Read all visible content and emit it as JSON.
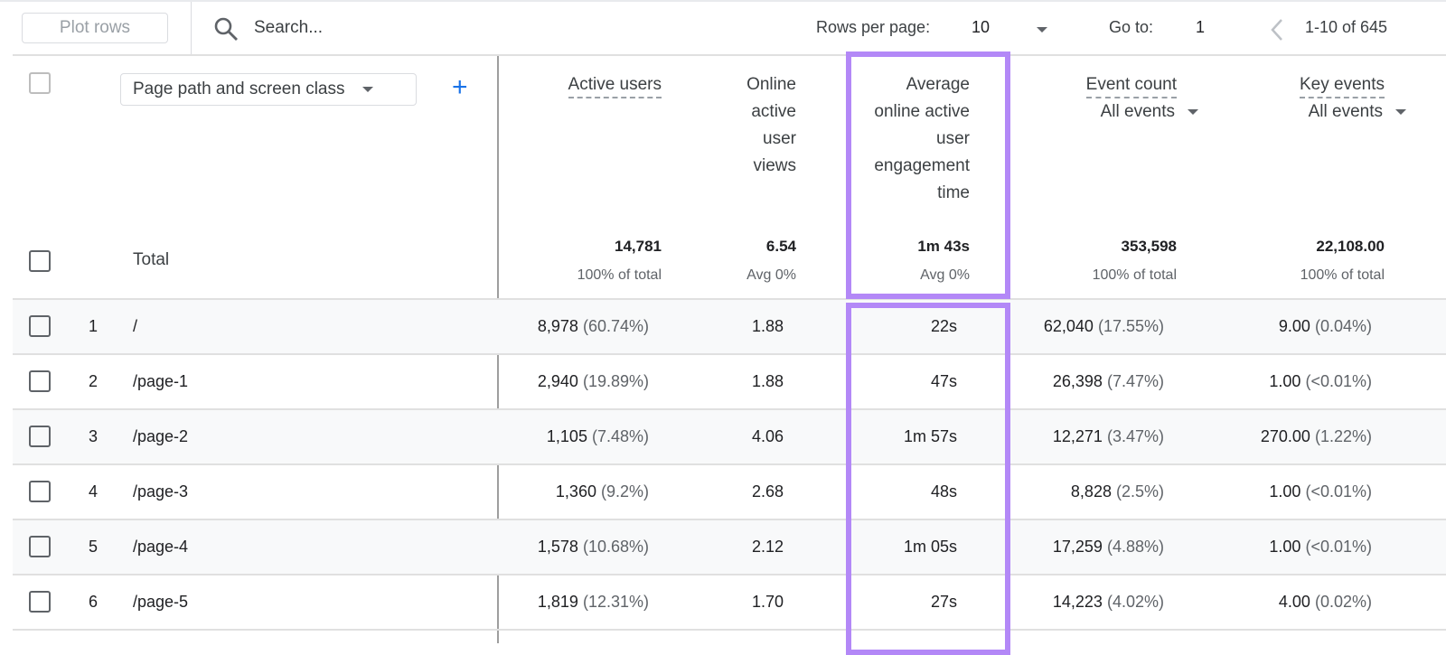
{
  "toolbar": {
    "plot_rows": "Plot rows",
    "search_placeholder": "Search...",
    "rows_per_page_label": "Rows per page:",
    "rows_per_page": "10",
    "goto_label": "Go to:",
    "goto_value": "1",
    "range": "1-10 of 645"
  },
  "dimension": {
    "label": "Page path and screen class",
    "add_icon": "plus-icon"
  },
  "columns": [
    {
      "lines": [
        "Active users"
      ],
      "dashed": true
    },
    {
      "lines": [
        "Online",
        "active",
        "user",
        "views"
      ]
    },
    {
      "lines": [
        "Average",
        "online active",
        "user",
        "engagement",
        "time"
      ],
      "highlighted": true
    },
    {
      "lines": [
        "Event count"
      ],
      "dashed": true,
      "filter": "All events"
    },
    {
      "lines": [
        "Key events"
      ],
      "dashed": true,
      "filter": "All events"
    }
  ],
  "total": {
    "label": "Total",
    "values": [
      {
        "value": "14,781",
        "sub": "100% of total"
      },
      {
        "value": "6.54",
        "sub": "Avg 0%"
      },
      {
        "value": "1m 43s",
        "sub": "Avg 0%"
      },
      {
        "value": "353,598",
        "sub": "100% of total"
      },
      {
        "value": "22,108.00",
        "sub": "100% of total"
      }
    ]
  },
  "rows": [
    {
      "n": "1",
      "path": "/",
      "cells": [
        [
          "8,978",
          "(60.74%)"
        ],
        [
          "1.88",
          ""
        ],
        [
          "22s",
          ""
        ],
        [
          "62,040",
          "(17.55%)"
        ],
        [
          "9.00",
          "(0.04%)"
        ]
      ]
    },
    {
      "n": "2",
      "path": "/page-1",
      "cells": [
        [
          "2,940",
          "(19.89%)"
        ],
        [
          "1.88",
          ""
        ],
        [
          "47s",
          ""
        ],
        [
          "26,398",
          "(7.47%)"
        ],
        [
          "1.00",
          "(<0.01%)"
        ]
      ]
    },
    {
      "n": "3",
      "path": "/page-2",
      "cells": [
        [
          "1,105",
          "(7.48%)"
        ],
        [
          "4.06",
          ""
        ],
        [
          "1m 57s",
          ""
        ],
        [
          "12,271",
          "(3.47%)"
        ],
        [
          "270.00",
          "(1.22%)"
        ]
      ]
    },
    {
      "n": "4",
      "path": "/page-3",
      "cells": [
        [
          "1,360",
          "(9.2%)"
        ],
        [
          "2.68",
          ""
        ],
        [
          "48s",
          ""
        ],
        [
          "8,828",
          "(2.5%)"
        ],
        [
          "1.00",
          "(<0.01%)"
        ]
      ]
    },
    {
      "n": "5",
      "path": "/page-4",
      "cells": [
        [
          "1,578",
          "(10.68%)"
        ],
        [
          "2.12",
          ""
        ],
        [
          "1m 05s",
          ""
        ],
        [
          "17,259",
          "(4.88%)"
        ],
        [
          "1.00",
          "(<0.01%)"
        ]
      ]
    },
    {
      "n": "6",
      "path": "/page-5",
      "cells": [
        [
          "1,819",
          "(12.31%)"
        ],
        [
          "1.70",
          ""
        ],
        [
          "27s",
          ""
        ],
        [
          "14,223",
          "(4.02%)"
        ],
        [
          "4.00",
          "(0.02%)"
        ]
      ]
    }
  ],
  "colors": {
    "highlight": "#b388f7",
    "accent": "#1a73e8"
  }
}
